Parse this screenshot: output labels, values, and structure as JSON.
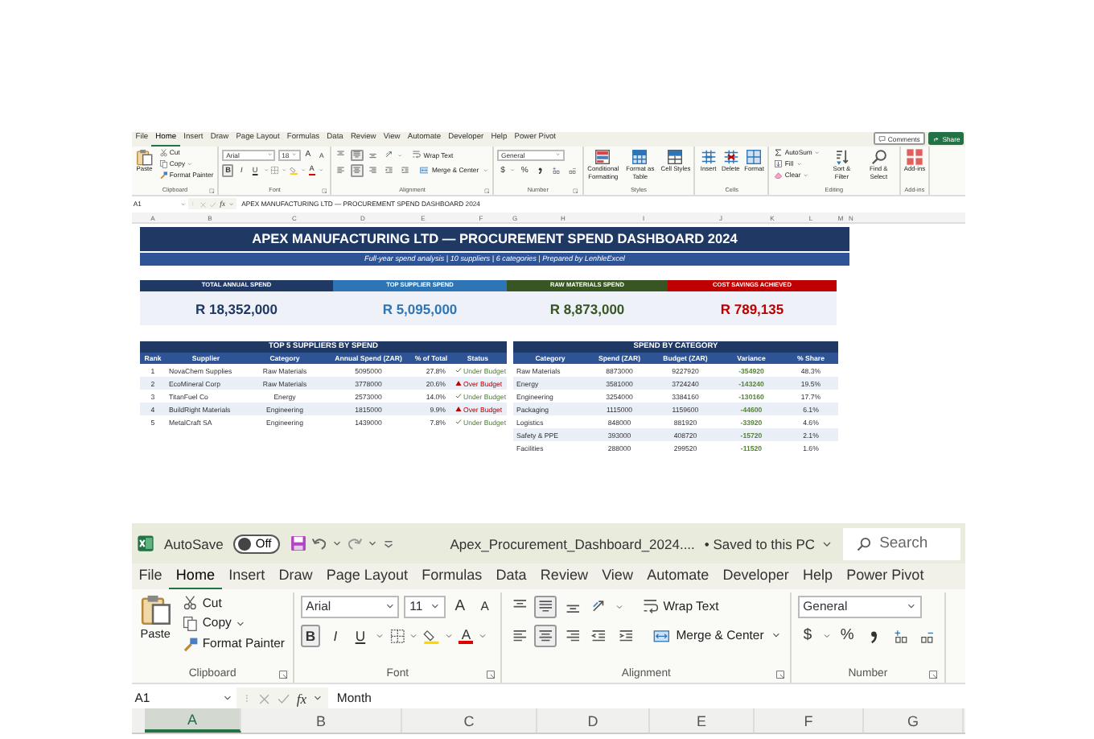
{
  "mini_window": {
    "tabs": [
      {
        "label": "File",
        "selected": false
      },
      {
        "label": "Home",
        "selected": true
      },
      {
        "label": "Insert",
        "selected": false
      },
      {
        "label": "Draw",
        "selected": false
      },
      {
        "label": "Page Layout",
        "selected": false
      },
      {
        "label": "Formulas",
        "selected": false
      },
      {
        "label": "Data",
        "selected": false
      },
      {
        "label": "Review",
        "selected": false
      },
      {
        "label": "View",
        "selected": false
      },
      {
        "label": "Automate",
        "selected": false
      },
      {
        "label": "Developer",
        "selected": false
      },
      {
        "label": "Help",
        "selected": false
      },
      {
        "label": "Power Pivot",
        "selected": false
      }
    ],
    "actions": [
      {
        "kind": "comments",
        "label": "Comments"
      },
      {
        "kind": "share",
        "label": "Share"
      }
    ],
    "ribbon": [
      {
        "kind": "clipboard",
        "label": "Clipboard",
        "paste": "Paste",
        "actions": [
          "Cut",
          "Copy",
          "Format Painter"
        ]
      },
      {
        "kind": "font",
        "label": "Font",
        "font": "Arial",
        "size": "18",
        "size_buttons": [
          "A",
          "A"
        ],
        "styles": [
          {
            "label": "B",
            "on": true
          },
          {
            "label": "I",
            "on": false
          },
          {
            "label": "U",
            "on": false
          }
        ],
        "color_letter": "A"
      },
      {
        "kind": "alignment",
        "label": "Alignment",
        "vertical": [
          {
            "on": false
          },
          {
            "on": true
          },
          {
            "on": false
          }
        ],
        "horizontal": [
          {
            "on": false
          },
          {
            "on": true
          },
          {
            "on": false
          }
        ],
        "wrap": "Wrap Text",
        "merge": "Merge & Center"
      },
      {
        "kind": "number",
        "label": "Number",
        "format": "General",
        "symbols": [
          "$",
          "%"
        ]
      },
      {
        "kind": "styles",
        "label": "Styles",
        "buttons": [
          "Conditional Formatting",
          "Format as Table",
          "Cell Styles"
        ]
      },
      {
        "kind": "cells",
        "label": "Cells",
        "buttons": [
          "Insert",
          "Delete",
          "Format"
        ]
      },
      {
        "kind": "editing",
        "label": "Editing",
        "actions": [
          "AutoSum",
          "Fill",
          "Clear"
        ],
        "buttons": [
          "Sort & Filter",
          "Find & Select"
        ]
      },
      {
        "kind": "addins",
        "label": "Add-ins",
        "buttons": [
          "Add-ins"
        ]
      }
    ],
    "formula_bar": {
      "name_box": "A1",
      "fx": "fx",
      "formula": "APEX MANUFACTURING LTD — PROCUREMENT SPEND DASHBOARD 2024"
    },
    "columns": [
      "A",
      "B",
      "C",
      "D",
      "E",
      "F",
      "G",
      "H",
      "I",
      "J",
      "K",
      "L",
      "M",
      "N"
    ],
    "dashboard": {
      "title": "APEX MANUFACTURING LTD — PROCUREMENT SPEND DASHBOARD 2024",
      "subtitle": "Full-year spend analysis | 10 suppliers | 6 categories | Prepared by LenhleExcel",
      "kpis": [
        {
          "label": "TOTAL ANNUAL SPEND",
          "value": "R 18,352,000",
          "color": "#1f3864"
        },
        {
          "label": "TOP SUPPLIER SPEND",
          "value": "R 5,095,000",
          "color": "#2e75b6"
        },
        {
          "label": "RAW MATERIALS SPEND",
          "value": "R 8,873,000",
          "color": "#375623"
        },
        {
          "label": "COST SAVINGS ACHIEVED",
          "value": "R 789,135",
          "color": "#c00000"
        }
      ],
      "suppliers": {
        "title": "TOP 5 SUPPLIERS BY SPEND",
        "columns": [
          "Rank",
          "Supplier",
          "Category",
          "Annual Spend (ZAR)",
          "% of Total",
          "Status"
        ],
        "rows": [
          {
            "rank": "1",
            "supplier": "NovaChem Supplies",
            "category": "Raw Materials",
            "spend": "5095000",
            "share": "27.8%",
            "status": "Under Budget",
            "over_budget": false
          },
          {
            "rank": "2",
            "supplier": "EcoMineral Corp",
            "category": "Raw Materials",
            "spend": "3778000",
            "share": "20.6%",
            "status": "Over Budget",
            "over_budget": true
          },
          {
            "rank": "3",
            "supplier": "TitanFuel Co",
            "category": "Energy",
            "spend": "2573000",
            "share": "14.0%",
            "status": "Under Budget",
            "over_budget": false
          },
          {
            "rank": "4",
            "supplier": "BuildRight Materials",
            "category": "Engineering",
            "spend": "1815000",
            "share": "9.9%",
            "status": "Over Budget",
            "over_budget": true
          },
          {
            "rank": "5",
            "supplier": "MetalCraft SA",
            "category": "Engineering",
            "spend": "1439000",
            "share": "7.8%",
            "status": "Under Budget",
            "over_budget": false
          }
        ]
      },
      "categories": {
        "title": "SPEND BY CATEGORY",
        "columns": [
          "Category",
          "Spend (ZAR)",
          "Budget (ZAR)",
          "Variance",
          "% Share"
        ],
        "rows": [
          {
            "category": "Raw Materials",
            "spend": "8873000",
            "budget": "9227920",
            "variance": "-354920",
            "share": "48.3%"
          },
          {
            "category": "Energy",
            "spend": "3581000",
            "budget": "3724240",
            "variance": "-143240",
            "share": "19.5%"
          },
          {
            "category": "Engineering",
            "spend": "3254000",
            "budget": "3384160",
            "variance": "-130160",
            "share": "17.7%"
          },
          {
            "category": "Packaging",
            "spend": "1115000",
            "budget": "1159600",
            "variance": "-44600",
            "share": "6.1%"
          },
          {
            "category": "Logistics",
            "spend": "848000",
            "budget": "881920",
            "variance": "-33920",
            "share": "4.6%"
          },
          {
            "category": "Safety & PPE",
            "spend": "393000",
            "budget": "408720",
            "variance": "-15720",
            "share": "2.1%"
          },
          {
            "category": "Facilities",
            "spend": "288000",
            "budget": "299520",
            "variance": "-11520",
            "share": "1.6%"
          }
        ]
      }
    }
  },
  "main_window": {
    "title_bar": {
      "autosave": "AutoSave",
      "autosave_on": false,
      "autosave_state": "Off",
      "file_name": "Apex_Procurement_Dashboard_2024....",
      "save_status": "• Saved to this PC",
      "search_placeholder": "Search"
    },
    "tabs": [
      {
        "label": "File",
        "selected": false
      },
      {
        "label": "Home",
        "selected": true
      },
      {
        "label": "Insert",
        "selected": false
      },
      {
        "label": "Draw",
        "selected": false
      },
      {
        "label": "Page Layout",
        "selected": false
      },
      {
        "label": "Formulas",
        "selected": false
      },
      {
        "label": "Data",
        "selected": false
      },
      {
        "label": "Review",
        "selected": false
      },
      {
        "label": "View",
        "selected": false
      },
      {
        "label": "Automate",
        "selected": false
      },
      {
        "label": "Developer",
        "selected": false
      },
      {
        "label": "Help",
        "selected": false
      },
      {
        "label": "Power Pivot",
        "selected": false
      }
    ],
    "ribbon": [
      {
        "kind": "clipboard",
        "label": "Clipboard",
        "paste": "Paste",
        "actions": [
          "Cut",
          "Copy",
          "Format Painter"
        ]
      },
      {
        "kind": "font",
        "label": "Font",
        "font": "Arial",
        "size": "11",
        "size_buttons": [
          "A",
          "A"
        ],
        "styles": [
          {
            "label": "B",
            "on": true
          },
          {
            "label": "I",
            "on": false
          },
          {
            "label": "U",
            "on": false
          }
        ],
        "color_letter": "A"
      },
      {
        "kind": "alignment",
        "label": "Alignment",
        "vertical": [
          {
            "on": false
          },
          {
            "on": true
          },
          {
            "on": false
          }
        ],
        "horizontal": [
          {
            "on": false
          },
          {
            "on": true
          },
          {
            "on": false
          }
        ],
        "wrap": "Wrap Text",
        "merge": "Merge & Center"
      },
      {
        "kind": "number",
        "label": "Number",
        "format": "General",
        "symbols": [
          "$",
          "%"
        ]
      }
    ],
    "formula_bar": {
      "name_box": "A1",
      "fx": "fx",
      "formula": "Month"
    },
    "columns": [
      {
        "label": "A",
        "selected": true
      },
      {
        "label": "B",
        "selected": false
      },
      {
        "label": "C",
        "selected": false
      },
      {
        "label": "D",
        "selected": false
      },
      {
        "label": "E",
        "selected": false
      },
      {
        "label": "F",
        "selected": false
      },
      {
        "label": "G",
        "selected": false
      }
    ]
  }
}
